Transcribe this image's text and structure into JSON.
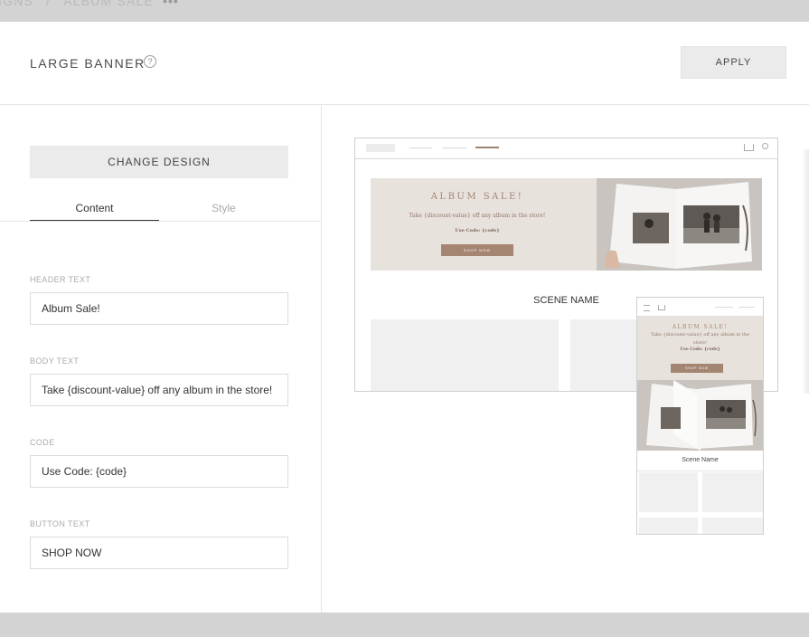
{
  "breadcrumb": {
    "parent": "PAIGNS",
    "current": "ALBUM SALE",
    "more_label": "•••"
  },
  "modal": {
    "title": "LARGE BANNER",
    "help_icon": "?",
    "apply_label": "APPLY"
  },
  "editor": {
    "change_design_label": "CHANGE DESIGN",
    "tabs": [
      {
        "label": "Content",
        "active": true
      },
      {
        "label": "Style",
        "active": false
      }
    ],
    "fields": [
      {
        "label": "HEADER TEXT",
        "value": "Album Sale!"
      },
      {
        "label": "BODY TEXT",
        "value": "Take {discount-value} off any album in the store!"
      },
      {
        "label": "CODE",
        "value": "Use Code: {code}"
      },
      {
        "label": "BUTTON TEXT",
        "value": "SHOP NOW"
      }
    ]
  },
  "preview": {
    "desktop": {
      "banner_header": "ALBUM SALE!",
      "banner_body": "Take {discount-value} off any album in the store!",
      "banner_code": "Use Code: {code}",
      "banner_button": "SHOP NOW",
      "scene_name": "SCENE NAME"
    },
    "mobile": {
      "banner_header": "ALBUM SALE!",
      "banner_body": "Take {discount-value} off any album in the store!",
      "banner_code": "Use Code: {code}",
      "banner_button": "SHOP NOW",
      "scene_name": "Scene Name"
    }
  },
  "colors": {
    "accent": "#a48572",
    "banner_bg": "#e8e2dd",
    "button_bg": "#ebebeb",
    "backdrop": "#d3d3d3"
  }
}
